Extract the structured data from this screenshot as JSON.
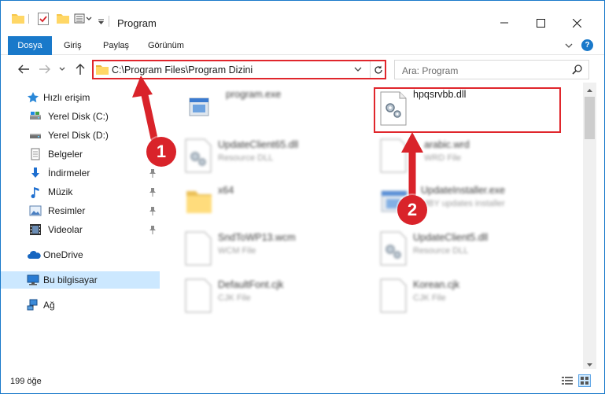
{
  "window": {
    "title": "Program",
    "controls": {
      "minimize": "minimize",
      "maximize": "maximize",
      "close": "close"
    }
  },
  "ribbon": {
    "tabs": [
      {
        "label": "Dosya"
      },
      {
        "label": "Giriş"
      },
      {
        "label": "Paylaş"
      },
      {
        "label": "Görünüm"
      }
    ],
    "help": "?"
  },
  "nav": {
    "address": "C:\\Program Files\\Program Dizini",
    "search_placeholder": "Ara: Program"
  },
  "sidebar": {
    "items": [
      {
        "label": "Hızlı erişim",
        "icon": "star-icon"
      },
      {
        "label": "Yerel Disk (C:)",
        "icon": "drive-icon"
      },
      {
        "label": "Yerel Disk (D:)",
        "icon": "drive-icon"
      },
      {
        "label": "Belgeler",
        "icon": "documents-icon"
      },
      {
        "label": "İndirmeler",
        "icon": "download-icon"
      },
      {
        "label": "Müzik",
        "icon": "music-icon"
      },
      {
        "label": "Resimler",
        "icon": "pictures-icon"
      },
      {
        "label": "Videolar",
        "icon": "video-icon"
      },
      {
        "label": "OneDrive",
        "icon": "cloud-icon"
      },
      {
        "label": "Bu bilgisayar",
        "icon": "computer-icon"
      },
      {
        "label": "Ağ",
        "icon": "network-icon"
      }
    ]
  },
  "files": [
    {
      "name": "program.exe",
      "desc": ""
    },
    {
      "name": "hpqsrvbb.dll",
      "desc": ""
    },
    {
      "name": "UpdateClient65.dll",
      "desc": "Resource DLL"
    },
    {
      "name": "arabic.wrd",
      "desc": "WRD File"
    },
    {
      "name": "x64",
      "desc": ""
    },
    {
      "name": "UpdateInstaller.exe",
      "desc": "MBY updates installer"
    },
    {
      "name": "SndToWP13.wcm",
      "desc": "WCM File"
    },
    {
      "name": "UpdateClient5.dll",
      "desc": "Resource DLL"
    },
    {
      "name": "DefaultFont.cjk",
      "desc": "CJK File"
    },
    {
      "name": "Korean.cjk",
      "desc": "CJK File"
    }
  ],
  "status": {
    "count": "199 öğe"
  },
  "callouts": {
    "one": "1",
    "two": "2"
  },
  "colors": {
    "accent": "#1979ca",
    "highlight": "#e0262c",
    "callout": "#d9232a",
    "selected": "#cce8ff"
  }
}
